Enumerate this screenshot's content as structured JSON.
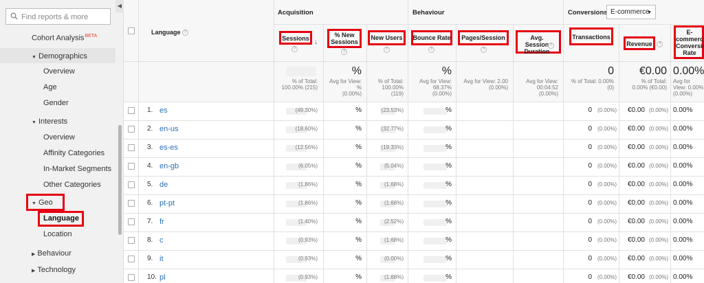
{
  "sidebar": {
    "search_placeholder": "Find reports & more",
    "items": [
      {
        "label": "Cohort Analysis",
        "badge": "BETA"
      },
      {
        "label": "Demographics"
      },
      {
        "label": "Overview"
      },
      {
        "label": "Age"
      },
      {
        "label": "Gender"
      },
      {
        "label": "Interests"
      },
      {
        "label": "Overview"
      },
      {
        "label": "Affinity Categories"
      },
      {
        "label": "In-Market Segments"
      },
      {
        "label": "Other Categories"
      },
      {
        "label": "Geo"
      },
      {
        "label": "Language"
      },
      {
        "label": "Location"
      },
      {
        "label": "Behaviour"
      },
      {
        "label": "Technology"
      }
    ]
  },
  "table": {
    "dimension_header": "Language",
    "groups": {
      "acquisition": "Acquisition",
      "behaviour": "Behaviour",
      "conversions": "Conversions"
    },
    "conversion_select": "E-commerce",
    "columns": {
      "sessions": "Sessions",
      "new_sessions": "% New Sessions",
      "new_users": "New Users",
      "bounce_rate": "Bounce Rate",
      "pages_session": "Pages/Session",
      "avg_session_duration": "Avg. Session Duration",
      "transactions": "Transactions",
      "revenue": "Revenue",
      "ecommerce_rate": "E-commerce Conversion Rate"
    },
    "totals": {
      "sessions": "% of Total:\n100.00% (215)",
      "new_sessions_big": "%",
      "new_sessions": "Avg for View:\n%\n(0.00%)",
      "new_users": "% of Total:\n100.00%\n(119)",
      "bounce_big": "%",
      "bounce": "Avg for View:\n68.37%\n(0.00%)",
      "pages": "Avg for View: 2.00\n(0.00%)",
      "duration": "Avg for View:\n00:04:52\n(0.00%)",
      "transactions_big": "0",
      "transactions": "% of Total: 0.00%\n(0)",
      "revenue_big": "€0.00",
      "revenue": "% of Total:\n0.00% (€0.00)",
      "rate_big": "0.00%",
      "rate": "Avg for\nView: 0.00%\n(0.00%)"
    },
    "rows": [
      {
        "num": "1.",
        "lang": "es",
        "sessions_pct": "(49.30%)",
        "new_sessions": "%",
        "new_users_pct": "(23.53%)",
        "bounce": "%",
        "transactions": "0",
        "trans_pct": "(0.00%)",
        "revenue": "€0.00",
        "rev_pct": "(0.00%)",
        "rate": "0.00%"
      },
      {
        "num": "2.",
        "lang": "en-us",
        "sessions_pct": "(18.60%)",
        "new_sessions": "%",
        "new_users_pct": "(32.77%)",
        "bounce": "%",
        "transactions": "0",
        "trans_pct": "(0.00%)",
        "revenue": "€0.00",
        "rev_pct": "(0.00%)",
        "rate": "0.00%"
      },
      {
        "num": "3.",
        "lang": "es-es",
        "sessions_pct": "(12.56%)",
        "new_sessions": "%",
        "new_users_pct": "(19.33%)",
        "bounce": "%",
        "transactions": "0",
        "trans_pct": "(0.00%)",
        "revenue": "€0.00",
        "rev_pct": "(0.00%)",
        "rate": "0.00%"
      },
      {
        "num": "4.",
        "lang": "en-gb",
        "sessions_pct": "(6.05%)",
        "new_sessions": "%",
        "new_users_pct": "(5.04%)",
        "bounce": "%",
        "transactions": "0",
        "trans_pct": "(0.00%)",
        "revenue": "€0.00",
        "rev_pct": "(0.00%)",
        "rate": "0.00%"
      },
      {
        "num": "5.",
        "lang": "de",
        "sessions_pct": "(1.86%)",
        "new_sessions": "%",
        "new_users_pct": "(1.68%)",
        "bounce": "%",
        "transactions": "0",
        "trans_pct": "(0.00%)",
        "revenue": "€0.00",
        "rev_pct": "(0.00%)",
        "rate": "0.00%"
      },
      {
        "num": "6.",
        "lang": "pt-pt",
        "sessions_pct": "(1.86%)",
        "new_sessions": "%",
        "new_users_pct": "(1.68%)",
        "bounce": "%",
        "transactions": "0",
        "trans_pct": "(0.00%)",
        "revenue": "€0.00",
        "rev_pct": "(0.00%)",
        "rate": "0.00%"
      },
      {
        "num": "7.",
        "lang": "fr",
        "sessions_pct": "(1.40%)",
        "new_sessions": "%",
        "new_users_pct": "(2.52%)",
        "bounce": "%",
        "transactions": "0",
        "trans_pct": "(0.00%)",
        "revenue": "€0.00",
        "rev_pct": "(0.00%)",
        "rate": "0.00%"
      },
      {
        "num": "8.",
        "lang": "c",
        "sessions_pct": "(0.93%)",
        "new_sessions": "%",
        "new_users_pct": "(1.68%)",
        "bounce": "%",
        "transactions": "0",
        "trans_pct": "(0.00%)",
        "revenue": "€0.00",
        "rev_pct": "(0.00%)",
        "rate": "0.00%"
      },
      {
        "num": "9.",
        "lang": "it",
        "sessions_pct": "(0.93%)",
        "new_sessions": "%",
        "new_users_pct": "(0.00%)",
        "bounce": "%",
        "transactions": "0",
        "trans_pct": "(0.00%)",
        "revenue": "€0.00",
        "rev_pct": "(0.00%)",
        "rate": "0.00%"
      },
      {
        "num": "10.",
        "lang": "pl",
        "sessions_pct": "(0.93%)",
        "new_sessions": "%",
        "new_users_pct": "(1.68%)",
        "bounce": "%",
        "transactions": "0",
        "trans_pct": "(0.00%)",
        "revenue": "€0.00",
        "rev_pct": "(0.00%)",
        "rate": "0.00%"
      }
    ]
  },
  "colors": {
    "link": "#2a6fb7",
    "annotation": "#e50012",
    "beta": "#e4452b"
  }
}
